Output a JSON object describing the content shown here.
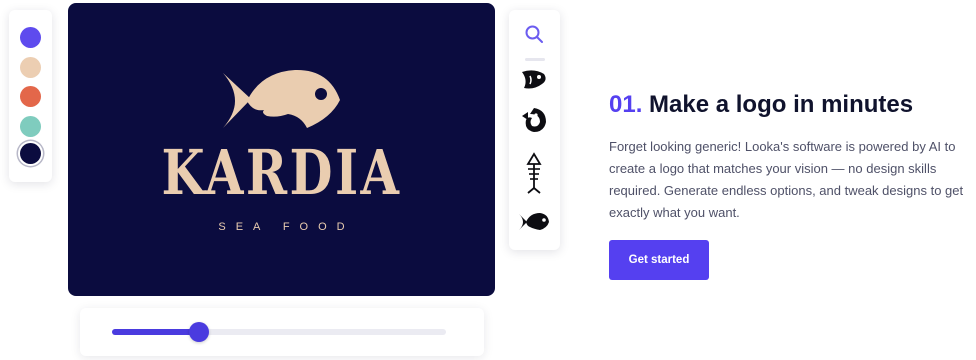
{
  "palette": {
    "swatches": [
      {
        "name": "purple",
        "color": "#5e4bee"
      },
      {
        "name": "sand",
        "color": "#ecceb2"
      },
      {
        "name": "coral",
        "color": "#e3674a"
      },
      {
        "name": "teal",
        "color": "#7fccbe"
      },
      {
        "name": "navy",
        "color": "#0b0c3f"
      }
    ],
    "selected": "navy"
  },
  "logo": {
    "brand_name": "KARDIA",
    "tagline": "SEA FOOD",
    "background_color": "#0b0c3f",
    "foreground_color": "#eacdb0",
    "icon": "fish-icon"
  },
  "icon_picker": {
    "icons": [
      "search-icon",
      "fish-head-icon",
      "fish-curled-icon",
      "fish-skeleton-icon",
      "fish-icon"
    ],
    "accent_color": "#6b5cf0"
  },
  "slider": {
    "value": 0.26,
    "accent_color": "#4a3bdf"
  },
  "feature": {
    "number": "01.",
    "title": "Make a logo in minutes",
    "description": "Forget looking generic! Looka's software is powered by AI to create a logo that matches your vision — no design skills required. Generate endless options, and tweak designs to get exactly what you want.",
    "cta_label": "Get started",
    "accent_color": "#5540f0"
  }
}
